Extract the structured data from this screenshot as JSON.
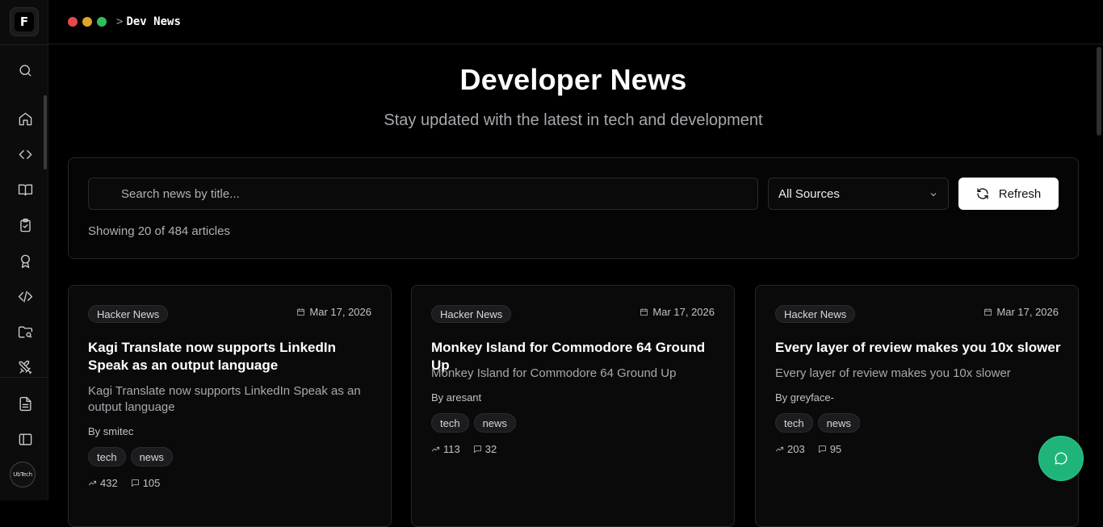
{
  "breadcrumb": {
    "prefix": ">",
    "page": "Dev News"
  },
  "colors": {
    "close": "#e5484d",
    "minimize": "#e0a526",
    "maximize": "#2fbf5f",
    "accent": "#1fb57a"
  },
  "sidebar": {
    "logo_glyph": "F",
    "items": [
      {
        "icon": "search-icon"
      },
      {
        "icon": "home-icon"
      },
      {
        "icon": "code-icon"
      },
      {
        "icon": "book-icon"
      },
      {
        "icon": "clipboard-check-icon"
      },
      {
        "icon": "award-icon"
      },
      {
        "icon": "code-slash-icon"
      },
      {
        "icon": "folder-search-icon"
      },
      {
        "icon": "swords-icon"
      },
      {
        "icon": "document-icon"
      },
      {
        "icon": "sidebar-toggle-icon"
      }
    ],
    "avatar_text": "UbTech"
  },
  "hero": {
    "title": "Developer News",
    "subtitle": "Stay updated with the latest in tech and development"
  },
  "filters": {
    "search_placeholder": "Search news by title...",
    "source_selected": "All Sources",
    "refresh_label": "Refresh",
    "count_text": "Showing 20 of 484 articles"
  },
  "articles": [
    {
      "source": "Hacker News",
      "date": "Mar 17, 2026",
      "title": "Kagi Translate now supports LinkedIn Speak as an output language",
      "description": "Kagi Translate now supports LinkedIn Speak as an output language",
      "author": "By smitec",
      "tags": [
        "tech",
        "news"
      ],
      "points": "432",
      "comments": "105"
    },
    {
      "source": "Hacker News",
      "date": "Mar 17, 2026",
      "title": "Monkey Island for Commodore 64 Ground Up",
      "description": "Monkey Island for Commodore 64 Ground Up",
      "author": "By aresant",
      "tags": [
        "tech",
        "news"
      ],
      "points": "113",
      "comments": "32"
    },
    {
      "source": "Hacker News",
      "date": "Mar 17, 2026",
      "title": "Every layer of review makes you 10x slower",
      "description": "Every layer of review makes you 10x slower",
      "author": "By greyface-",
      "tags": [
        "tech",
        "news"
      ],
      "points": "203",
      "comments": "95"
    }
  ]
}
